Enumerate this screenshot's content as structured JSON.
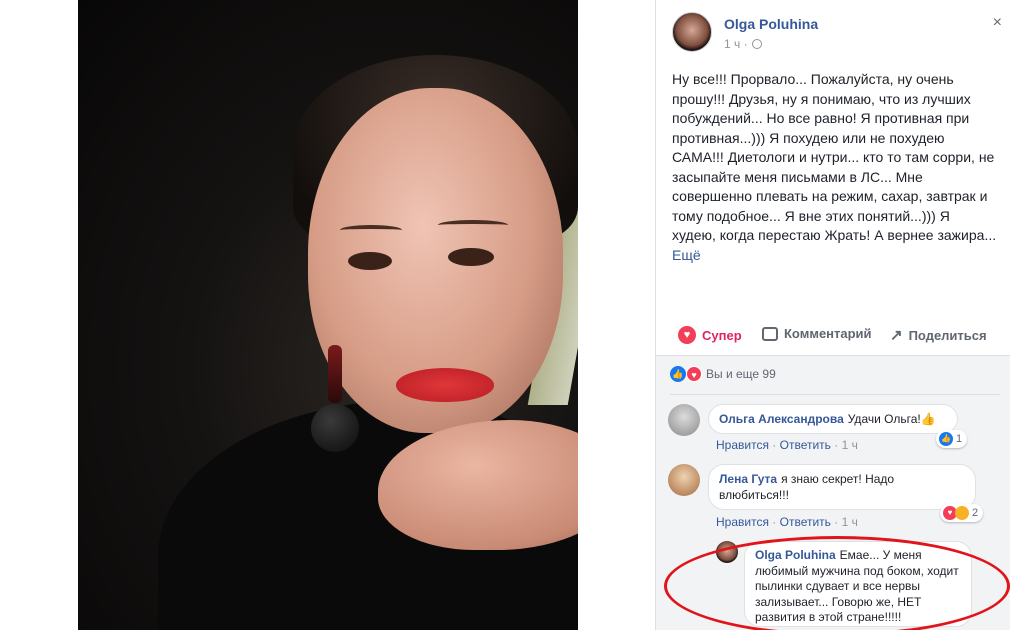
{
  "post": {
    "author": "Olga Poluhina",
    "time": "1 ч",
    "text": "Ну все!!! Прорвало... Пожалуйста, ну очень прошу!!! Друзья, ну я понимаю, что из лучших побуждений... Но все равно! Я противная при противная...))) Я похудею или не похудею САМА!!! Диетологи и нутри... кто то там сорри, не засыпайте меня письмами в ЛС... Мне совершенно плевать на режим, сахар, завтрак и тому подобное... Я вне этих понятий...))) Я худею, когда перестаю Жрать! А вернее зажира...",
    "see_more": "Ещё"
  },
  "actions": {
    "love": "Супер",
    "comment": "Комментарий",
    "share": "Поделиться"
  },
  "reactions_summary": "Вы и еще 99",
  "comments": [
    {
      "name": "Ольга Александрова",
      "text": "Удачи Ольга!👍",
      "like": "Нравится",
      "reply": "Ответить",
      "time": "1 ч",
      "reaction_count": "1"
    },
    {
      "name": "Лена Гута",
      "text": "я знаю секрет! Надо влюбиться!!!",
      "like": "Нравится",
      "reply": "Ответить",
      "time": "1 ч",
      "reaction_count": "2"
    },
    {
      "name": "Olga Poluhina",
      "text": "Емае... У меня любимый мужчина под боком, ходит пылинки сдувает и все нервы зализывает... Говорю же, НЕТ развития в этой стране!!!!!"
    }
  ],
  "icons": {
    "close": "×",
    "globe": "globe-icon",
    "heart": "♥",
    "like": "👍",
    "share": "↗"
  }
}
